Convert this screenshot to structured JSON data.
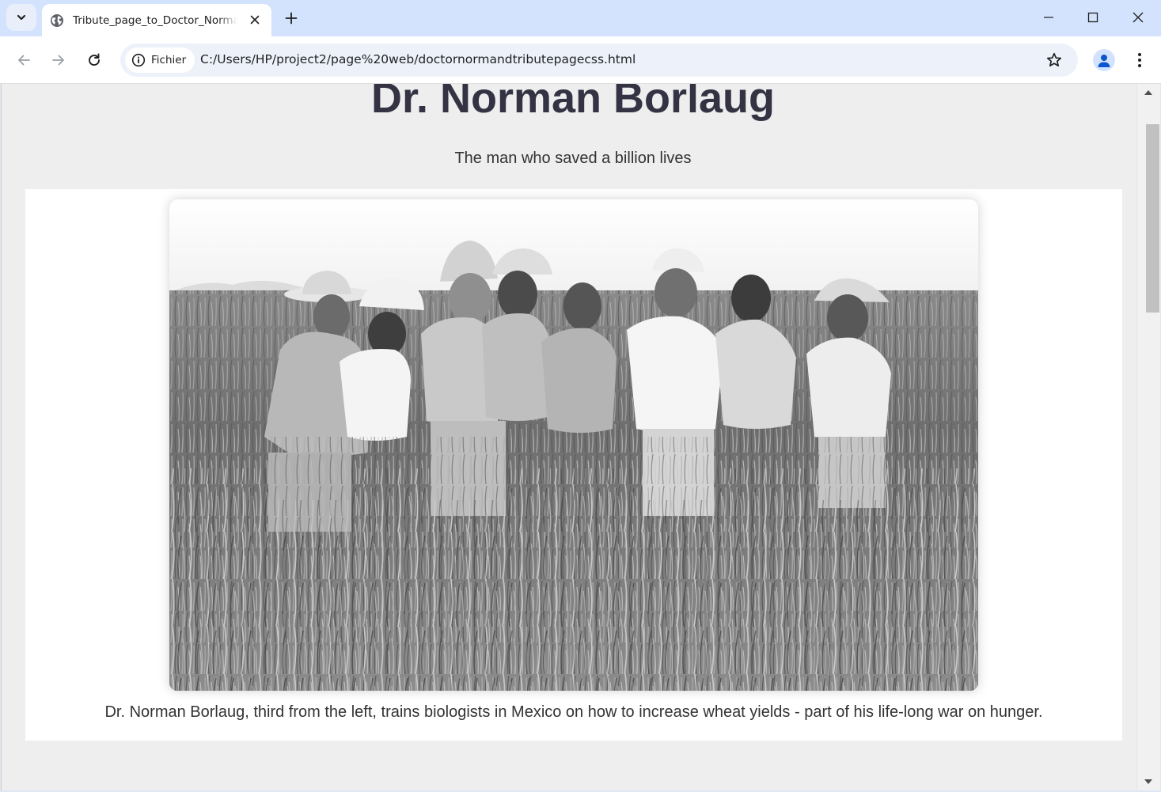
{
  "browser": {
    "tab": {
      "title": "Tribute_page_to_Doctor_Norman_Borlaug"
    },
    "security_chip": {
      "label": "Fichier"
    },
    "address": {
      "url": "C:/Users/HP/project2/page%20web/doctornormandtributepagecss.html"
    }
  },
  "page": {
    "title": "Dr. Norman Borlaug",
    "subtitle": "The man who saved a billion lives",
    "image": {
      "description": "Black and white photo of Dr. Norman Borlaug and seven biologists standing in a wheat field"
    },
    "caption": "Dr. Norman Borlaug, third from the left, trains biologists in Mexico on how to increase wheat yields - part of his life-long war on hunger."
  },
  "colors": {
    "tabstrip_bg": "#d3e3fd",
    "omnibox_bg": "#edf2fa",
    "page_bg": "#eeeeee",
    "card_bg": "#ffffff",
    "heading_text": "#333344"
  }
}
